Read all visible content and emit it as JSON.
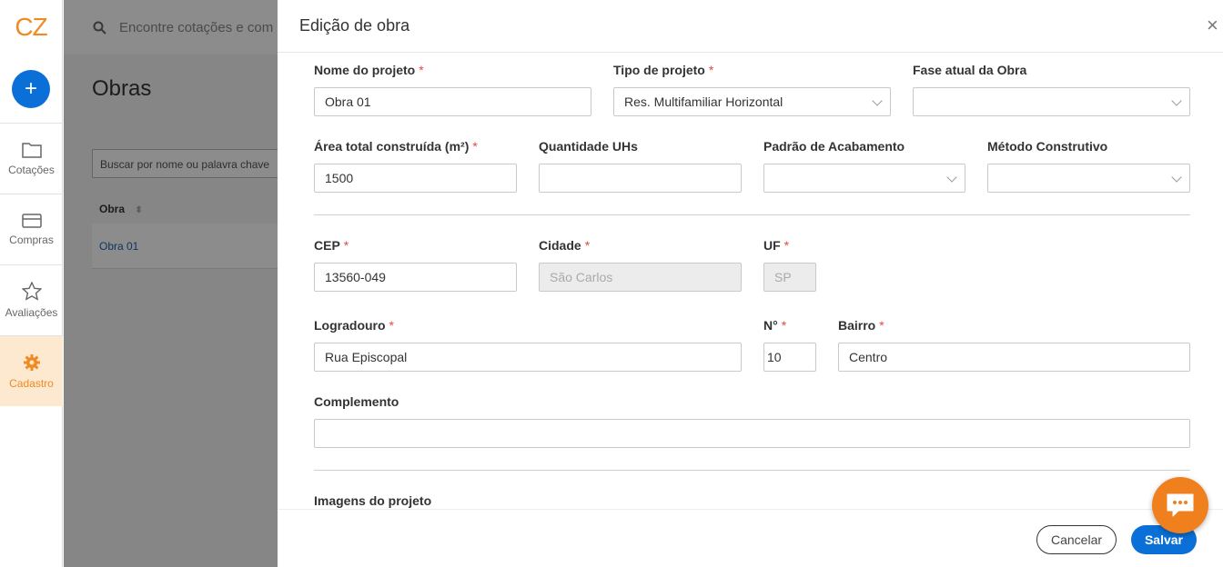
{
  "sidebar": {
    "logo": "CZ",
    "add_label": "+",
    "items": [
      {
        "label": "Cotações"
      },
      {
        "label": "Compras"
      },
      {
        "label": "Avaliações"
      },
      {
        "label": "Cadastro"
      }
    ]
  },
  "background": {
    "search_placeholder": "Encontre cotações e com",
    "title": "Obras",
    "filter_placeholder": "Buscar por nome ou palavra chave",
    "column_header": "Obra",
    "row_value": "Obra 01"
  },
  "modal": {
    "title": "Edição de obra",
    "close": "X",
    "fields": {
      "nome_projeto": {
        "label": "Nome do projeto",
        "value": "Obra 01"
      },
      "tipo_projeto": {
        "label": "Tipo de projeto",
        "value": "Res. Multifamiliar Horizontal"
      },
      "fase_atual": {
        "label": "Fase atual da Obra",
        "value": ""
      },
      "area_total": {
        "label": "Área total construída (m²)",
        "value": "1500"
      },
      "quantidade_uhs": {
        "label": "Quantidade UHs",
        "value": ""
      },
      "padrao_acabamento": {
        "label": "Padrão de Acabamento",
        "value": ""
      },
      "metodo_construtivo": {
        "label": "Método Construtivo",
        "value": ""
      },
      "cep": {
        "label": "CEP",
        "value": "13560-049"
      },
      "cidade": {
        "label": "Cidade",
        "value": "São Carlos"
      },
      "uf": {
        "label": "UF",
        "value": "SP"
      },
      "logradouro": {
        "label": "Logradouro",
        "value": "Rua Episcopal"
      },
      "numero": {
        "label": "N°",
        "value": "10"
      },
      "bairro": {
        "label": "Bairro",
        "value": "Centro"
      },
      "complemento": {
        "label": "Complemento",
        "value": ""
      }
    },
    "images_section": "Imagens do projeto",
    "required_mark": "*",
    "cancel_label": "Cancelar",
    "save_label": "Salvar"
  },
  "colors": {
    "accent": "#0a6fd6",
    "brand": "#f08a24",
    "required": "#e84a3c"
  }
}
